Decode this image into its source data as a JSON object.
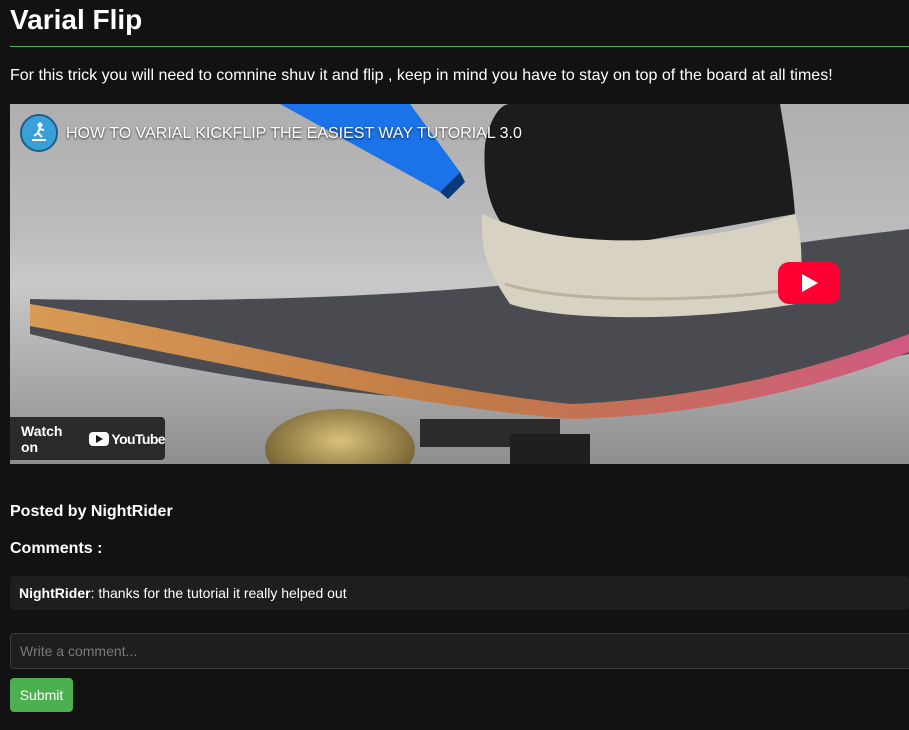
{
  "post": {
    "title": "Varial Flip",
    "description": "For this trick you will need to comnine shuv it and flip , keep in mind you have to stay on top of the board at all times!",
    "posted_by": "Posted by NightRider"
  },
  "video": {
    "title": "HOW TO VARIAL KICKFLIP THE EASIEST WAY TUTORIAL 3.0",
    "watch_on_label": "Watch on",
    "youtube_wordmark": "YouTube",
    "play_icon": "youtube-play-icon"
  },
  "comments": {
    "heading": "Comments :",
    "items": [
      {
        "author": "NightRider",
        "text": ": thanks for the tutorial it really helped out"
      }
    ]
  },
  "form": {
    "placeholder": "Write a comment...",
    "submit_label": "Submit"
  },
  "colors": {
    "background": "#121212",
    "accent": "#4caf50",
    "comment_bg": "#1e1e1e",
    "youtube_red": "#ff0033"
  }
}
